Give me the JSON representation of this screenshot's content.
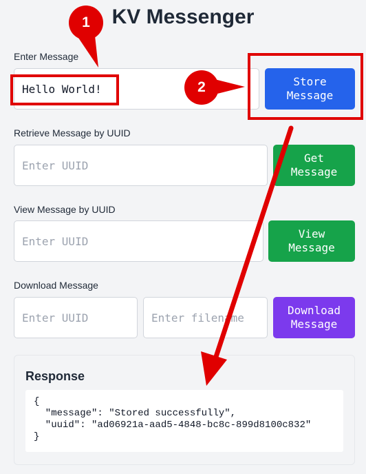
{
  "app": {
    "title": "KV Messenger"
  },
  "store": {
    "label": "Enter Message",
    "value": "Hello World!",
    "button_line1": "Store",
    "button_line2": "Message"
  },
  "retrieve": {
    "label": "Retrieve Message by UUID",
    "placeholder": "Enter UUID",
    "button_line1": "Get",
    "button_line2": "Message"
  },
  "view": {
    "label": "View Message by UUID",
    "placeholder": "Enter UUID",
    "button_line1": "View",
    "button_line2": "Message"
  },
  "download": {
    "label": "Download Message",
    "uuid_placeholder": "Enter UUID",
    "filename_placeholder": "Enter filename",
    "button_line1": "Download",
    "button_line2": "Message"
  },
  "response": {
    "heading": "Response",
    "line1": "{",
    "line2": "  \"message\": \"Stored successfully\",",
    "line3": "  \"uuid\": \"ad06921a-aad5-4848-bc8c-899d8100c832\"",
    "line4": "}"
  },
  "annotations": {
    "step1": "1",
    "step2": "2",
    "color": "#e00000"
  },
  "colors": {
    "store_button": "#2563eb",
    "get_button": "#16a34a",
    "view_button": "#16a34a",
    "download_button": "#7c3aed"
  }
}
